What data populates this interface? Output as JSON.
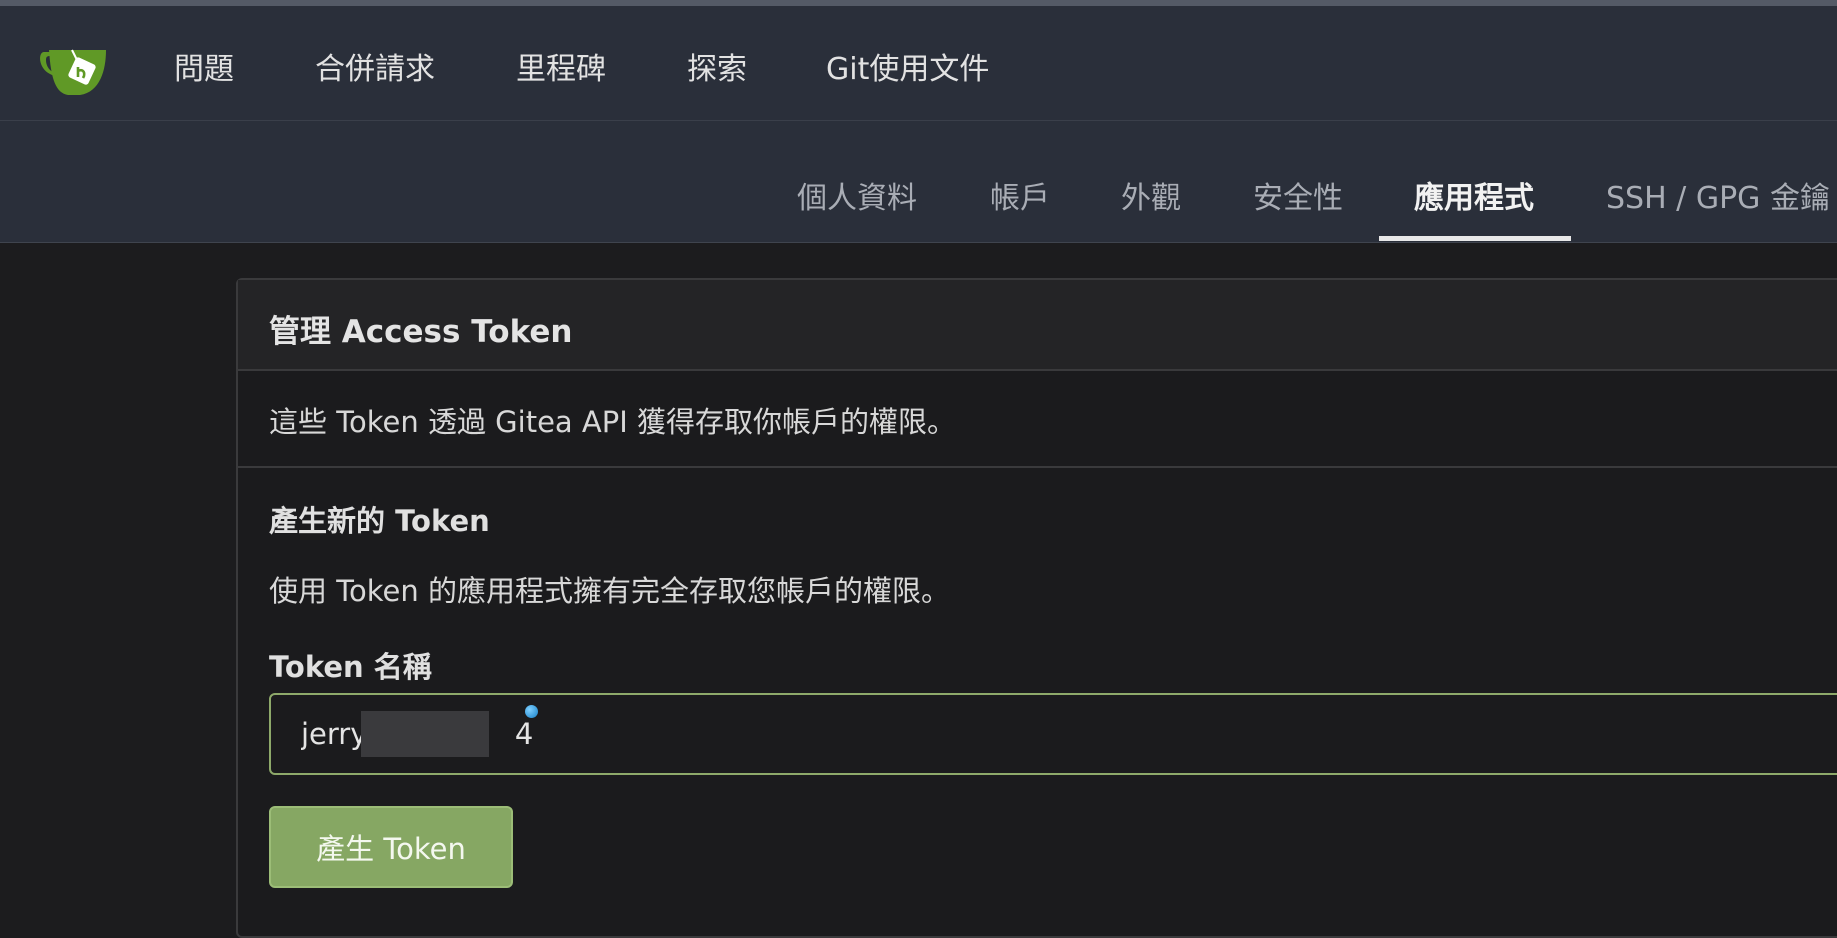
{
  "nav": {
    "items": [
      {
        "label": "問題"
      },
      {
        "label": "合併請求"
      },
      {
        "label": "里程碑"
      },
      {
        "label": "探索"
      },
      {
        "label": "Git使用文件"
      }
    ]
  },
  "settings_tabs": [
    {
      "label": "個人資料"
    },
    {
      "label": "帳戶"
    },
    {
      "label": "外觀"
    },
    {
      "label": "安全性"
    },
    {
      "label": "應用程式",
      "active": true
    },
    {
      "label": "SSH / GPG 金鑰"
    }
  ],
  "panel": {
    "title": "管理 Access Token",
    "description": "這些 Token 透過 Gitea API 獲得存取你帳戶的權限。",
    "generate": {
      "title": "產生新的 Token",
      "description": "使用 Token 的應用程式擁有完全存取您帳戶的權限。",
      "field_label": "Token 名稱",
      "token_name_value": "jerry                4",
      "button_label": "產生 Token"
    }
  },
  "colors": {
    "navbar_bg": "#2a2f3a",
    "page_bg": "#1c1c1e",
    "accent_green": "#86a763",
    "input_border": "#8ea96a",
    "logo_green": "#609926"
  },
  "icons": {
    "logo": "gitea-teacup-logo"
  }
}
